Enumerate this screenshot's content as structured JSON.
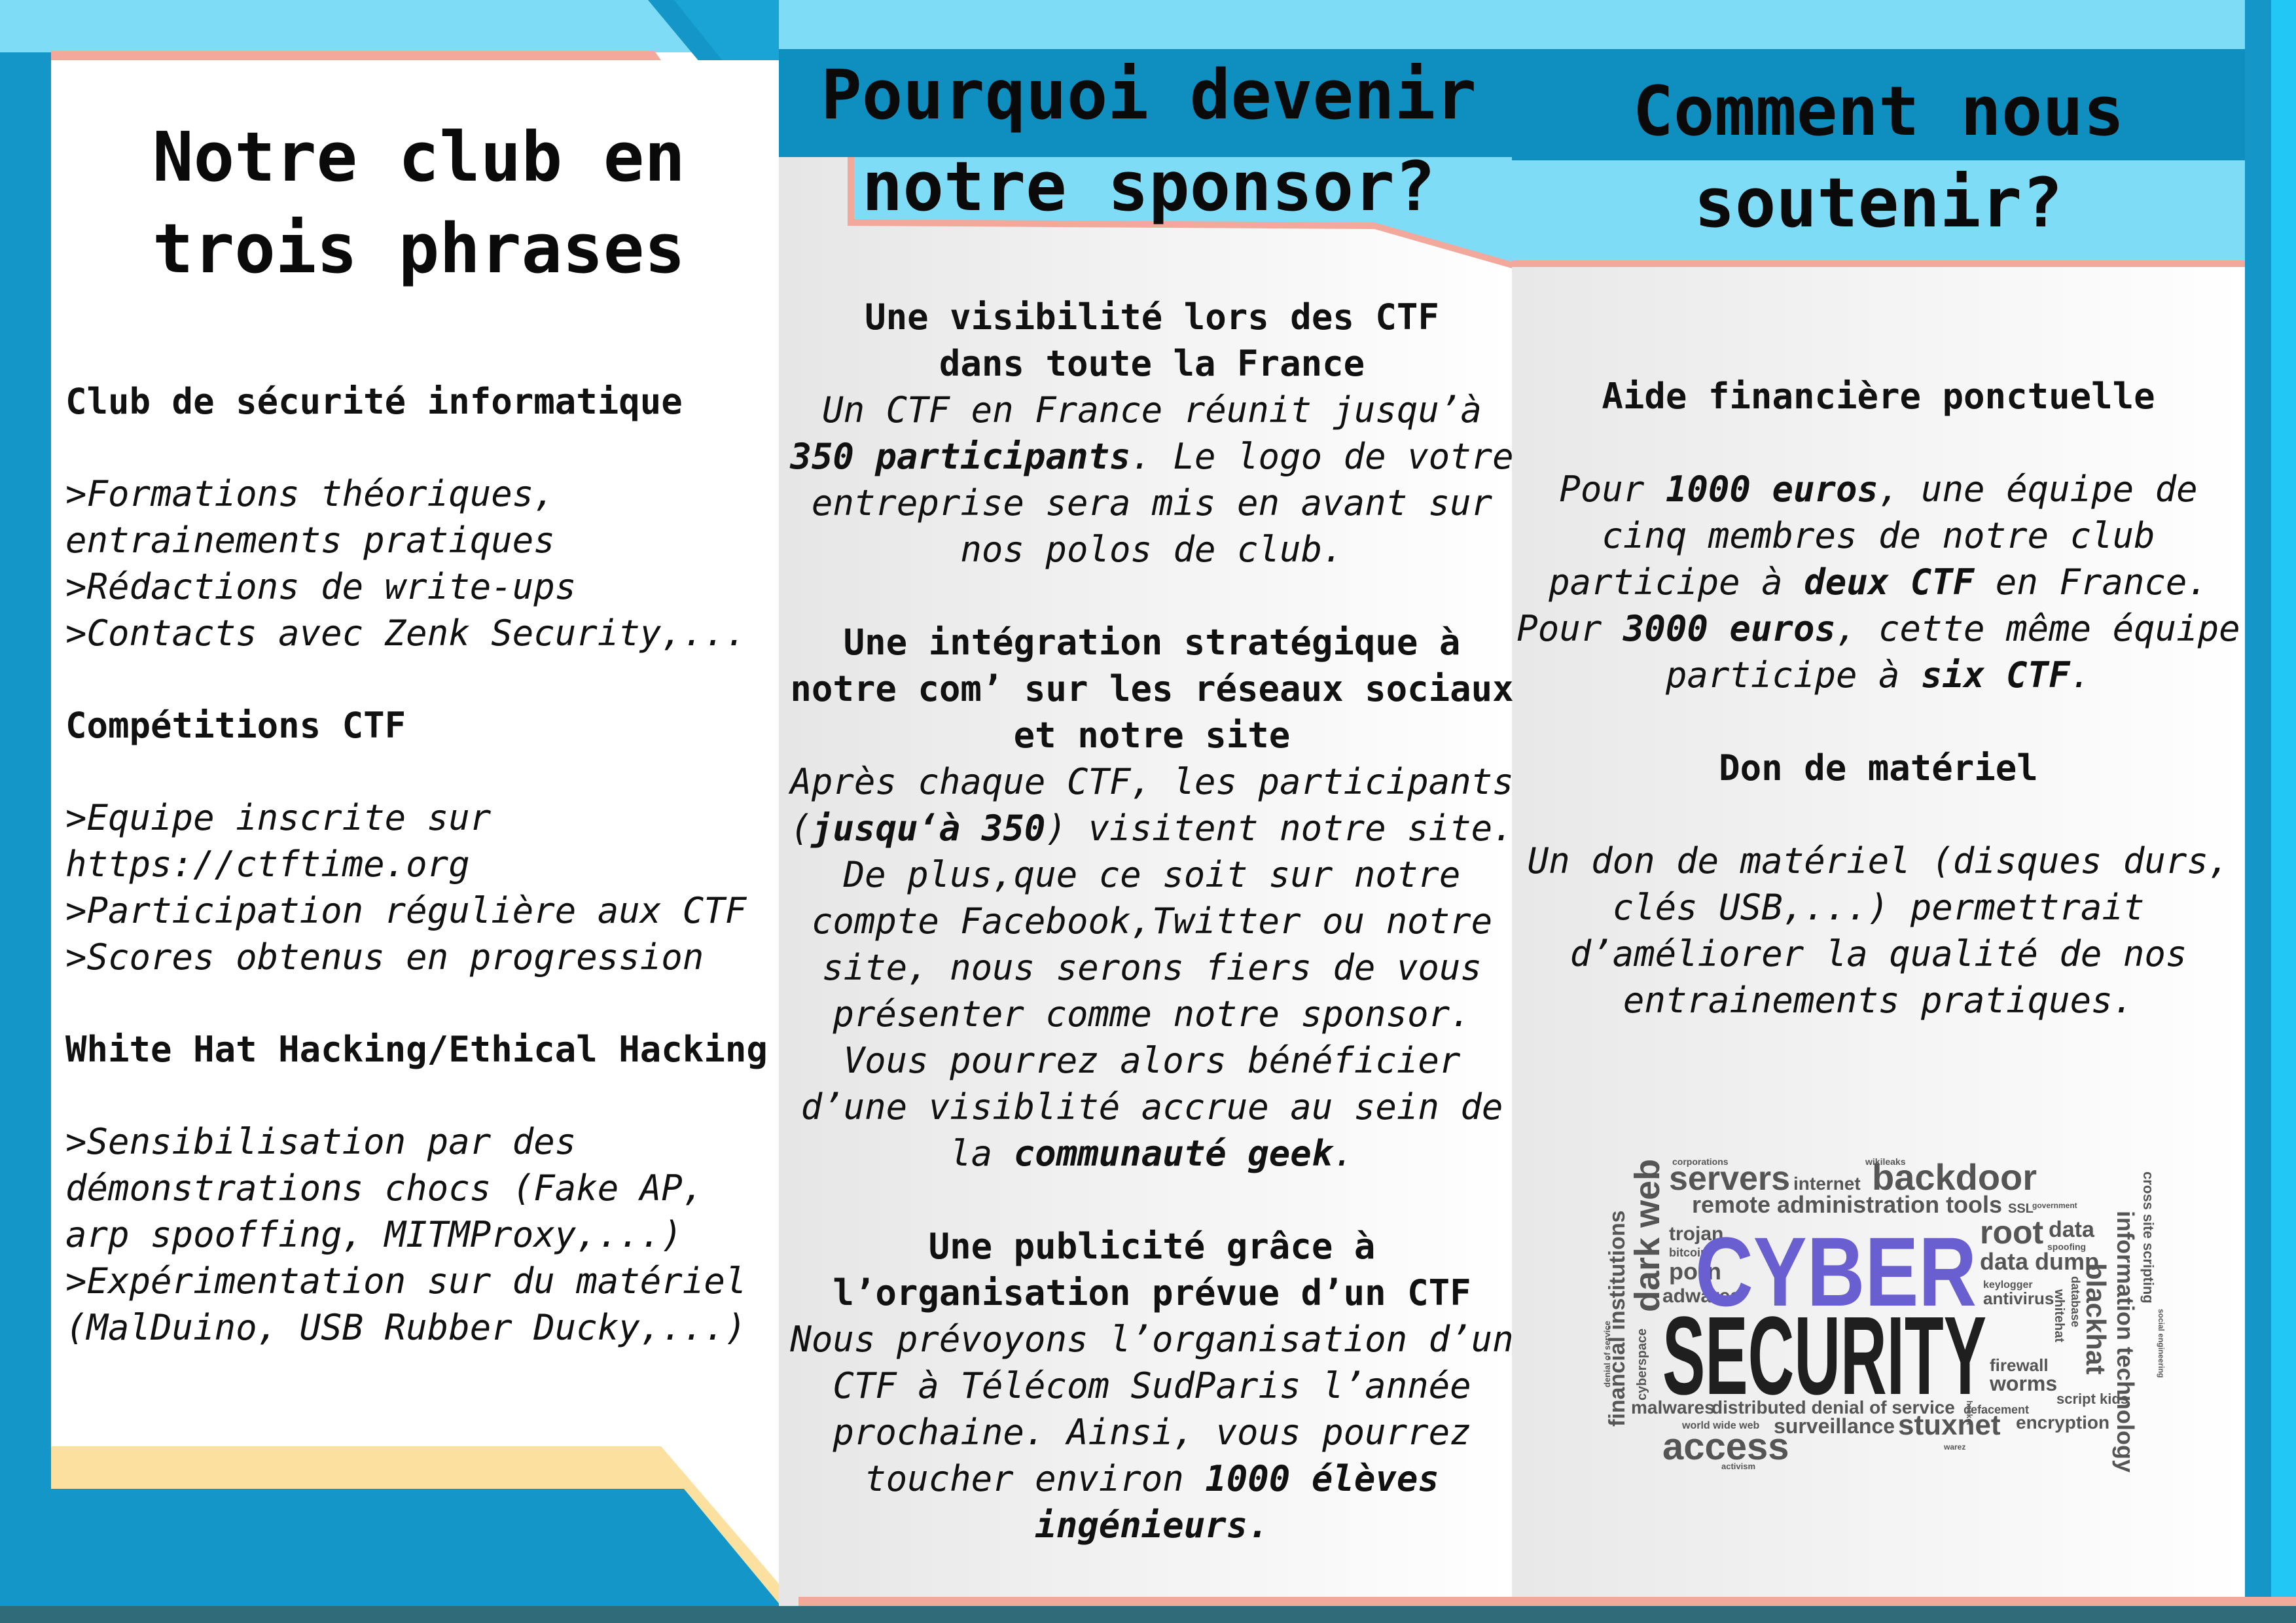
{
  "colors": {
    "blue_dark": "#0f8fbf",
    "blue_mid": "#3bb8e6",
    "blue_light": "#7fdcf7",
    "salmon": "#f2a89a",
    "cream": "#fbe0a0",
    "teal_bottom": "#2f6b78",
    "cyber_purple": "#6a5fd1",
    "cloud_gray": "#5a5a5a"
  },
  "panel1": {
    "title": "Notre club en\ntrois phrases",
    "sections": [
      {
        "heading": "Club de sécurité informatique",
        "items": [
          ">Formations théoriques,",
          "entrainements pratiques",
          ">Rédactions de write-ups",
          ">Contacts avec Zenk Security,..."
        ]
      },
      {
        "heading": "Compétitions CTF",
        "items": [
          ">Equipe inscrite sur",
          "https://ctftime.org",
          ">Participation régulière aux CTF",
          ">Scores obtenus en progression"
        ]
      },
      {
        "heading": "White Hat Hacking/Ethical Hacking",
        "items": [
          ">Sensibilisation par des",
          "démonstrations chocs (Fake AP,",
          "arp spooffing, MITMProxy,...)",
          ">Expérimentation sur du matériel",
          "(MalDuino, USB Rubber Ducky,...)"
        ]
      }
    ]
  },
  "panel2": {
    "title": "Pourquoi devenir\nnotre sponsor?",
    "sections": [
      {
        "heading_lines": [
          "Une visibilité lors des CTF",
          "dans toute la France"
        ],
        "text": {
          "t1": "Un CTF en France réunit jusqu’à ",
          "b1": "350 participants",
          "t2": ". Le logo de votre entreprise sera mis en avant sur nos polos de club."
        }
      },
      {
        "heading_lines": [
          "Une intégration stratégique à",
          "notre com’ sur les réseaux sociaux",
          "et notre site"
        ],
        "text": {
          "t1": "Après chaque CTF, les participants (",
          "b1": "jusqu‘à 350",
          "t2": ") visitent notre site. De plus,que ce soit sur notre compte Facebook,Twitter ou notre site, nous serons fiers de vous présenter comme notre sponsor. Vous pourrez alors bénéficier d’une visiblité accrue au sein de la ",
          "b2": "communauté geek",
          "t3": "."
        }
      },
      {
        "heading_lines": [
          "Une publicité grâce à",
          "l’organisation prévue d’un CTF"
        ],
        "text": {
          "t1": "Nous prévoyons l’organisation d’un CTF à Télécom SudParis l’année prochaine. Ainsi, vous pourrez toucher environ ",
          "b1": "1000 élèves ingénieurs."
        }
      }
    ]
  },
  "panel3": {
    "title": "Comment nous\nsoutenir?",
    "sections": [
      {
        "heading": "Aide financière ponctuelle",
        "text": {
          "t1": "Pour ",
          "b1": "1000 euros",
          "t2": ", une équipe de cinq membres de notre club participe à ",
          "b2": "deux CTF",
          "t3": " en France. Pour ",
          "b3": "3000 euros",
          "t4": ", cette même équipe participe à ",
          "b4": "six CTF",
          "t5": "."
        }
      },
      {
        "heading": "Don de matériel",
        "text": {
          "t1": "Un don de matériel (disques durs, clés USB,...) permettrait d’améliorer la qualité de nos entrainements pratiques."
        }
      }
    ]
  },
  "wordcloud": {
    "cyber": "CYBER",
    "security": "SECURITY",
    "words": {
      "servers": "servers",
      "internet": "internet",
      "backdoor": "backdoor",
      "corporations": "corporations",
      "wikileaks": "wikileaks",
      "remote": "remote administration tools",
      "ssl": "SSL",
      "government": "government",
      "darkweb": "dark web",
      "trojan": "trojan",
      "bitcoin": "bitcoin",
      "porn": "porn",
      "adwares": "adwares",
      "root": "root",
      "data": "data",
      "spoofing": "spoofing",
      "datadump": "data dump",
      "keylogger": "keylogger",
      "antivirus": "antivirus",
      "database": "database",
      "whitehat": "whitehat",
      "blackhat": "blackhat",
      "infotech": "information technology",
      "xss": "cross site scripting",
      "financial": "financial institutions",
      "cyberspace": "cyberspace",
      "dos": "denial of service",
      "hacker": "hacker",
      "firewall": "firewall",
      "worms": "worms",
      "scriptkids": "script kids",
      "socialeng": "social engineering",
      "malwares": "malwares",
      "ddos": "distributed denial of service",
      "defacement": "defacement",
      "encryption": "encryption",
      "www": "world wide web",
      "surveillance": "surveillance",
      "stuxnet": "stuxnet",
      "access": "access",
      "warez": "warez",
      "activism": "activism"
    }
  }
}
